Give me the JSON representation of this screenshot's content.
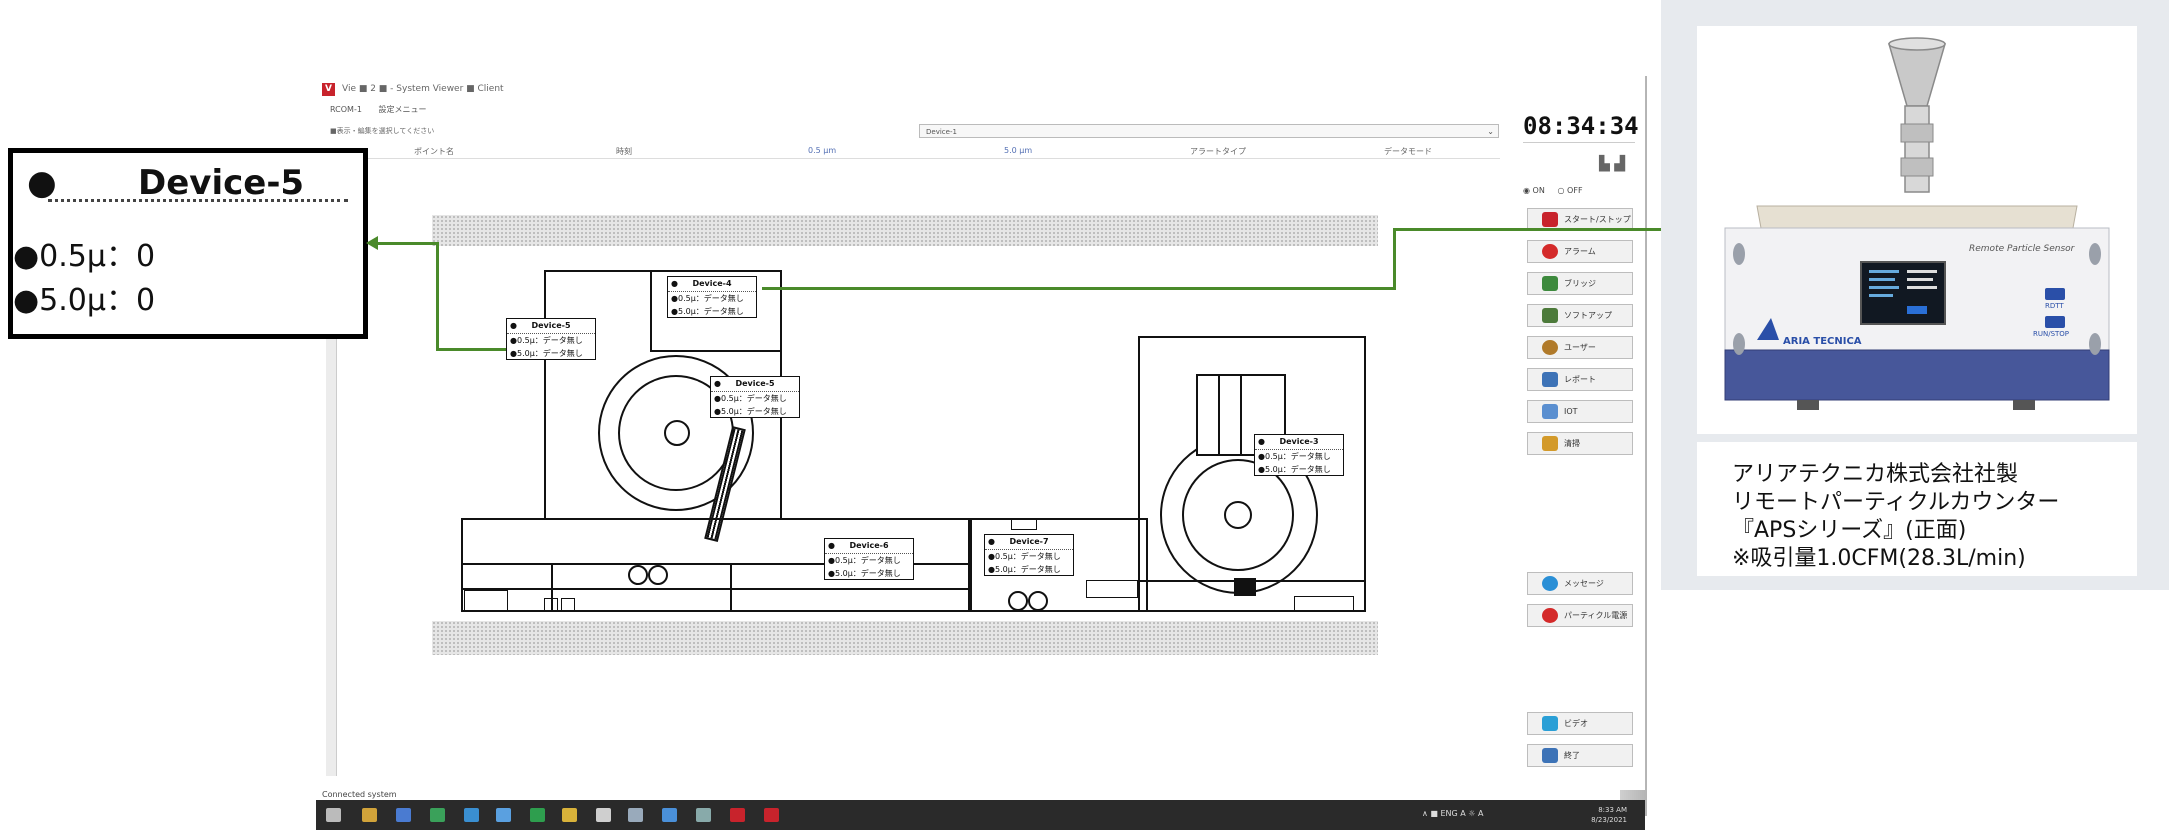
{
  "window": {
    "title": "Vie ■ 2 ■ - System Viewer ■ Client",
    "menu": [
      "RCOM-1",
      "設定メニュー"
    ],
    "toolbar_text": "■表示・編集を選択してください",
    "device_select": "Device-1",
    "columns": [
      "ポイント名",
      "時刻",
      "0.5 μm",
      "5.0 μm",
      "アラートタイプ",
      "データモード"
    ],
    "status": "Connected system"
  },
  "map_labels": [
    {
      "id": "device-5a",
      "name": "Device-5",
      "rows": [
        "●0.5μ：データ無し",
        "●5.0μ：データ無し"
      ]
    },
    {
      "id": "device-4",
      "name": "Device-4",
      "rows": [
        "●0.5μ：データ無し",
        "●5.0μ：データ無し"
      ]
    },
    {
      "id": "device-5b",
      "name": "Device-5",
      "rows": [
        "●0.5μ：データ無し",
        "●5.0μ：データ無し"
      ]
    },
    {
      "id": "device-3",
      "name": "Device-3",
      "rows": [
        "●0.5μ：データ無し",
        "●5.0μ：データ無し"
      ]
    },
    {
      "id": "device-6",
      "name": "Device-6",
      "rows": [
        "●0.5μ：データ無し",
        "●5.0μ：データ無し"
      ]
    },
    {
      "id": "device-7",
      "name": "Device-7",
      "rows": [
        "●0.5μ：データ無し",
        "●5.0μ：データ無し"
      ]
    }
  ],
  "panel": {
    "clock": "08:34:34",
    "radio_on": "◉ ON",
    "radio_off": "○ OFF",
    "buttons": [
      {
        "label": "スタート/ストップ",
        "color": "#c8232c"
      },
      {
        "label": "アラーム",
        "color": "#d42a2a"
      },
      {
        "label": "ブリッジ",
        "color": "#3d8a3d"
      },
      {
        "label": "ソフトアップ",
        "color": "#4c7a3a"
      },
      {
        "label": "ユーザー",
        "color": "#b07a2a"
      },
      {
        "label": "レポート",
        "color": "#3d73b7"
      },
      {
        "label": "IOT",
        "color": "#5a8fd0"
      },
      {
        "label": "清掃",
        "color": "#d39a2a"
      },
      {
        "label": "メッセージ",
        "color": "#2a8fd6"
      },
      {
        "label": "パーティクル電源",
        "color": "#d42a2a"
      },
      {
        "label": "ビデオ",
        "color": "#2a9fd6"
      },
      {
        "label": "終了",
        "color": "#3d73b7"
      }
    ]
  },
  "taskbar": {
    "time": "8:33 AM",
    "date": "8/23/2021",
    "tray": "∧ ■ ENG A ☼ A"
  },
  "callout": {
    "name": "Device-5",
    "bullet": "●",
    "row1": "●0.5μ：0",
    "row2": "●5.0μ：0"
  },
  "product": {
    "brand": "ARIA TECNICA",
    "device_caption": "Remote Particle Sensor",
    "btn1": "RDTT",
    "btn2": "RUN/STOP",
    "lines": [
      "アリアテクニカ株式会社社製",
      "リモートパーティクルカウンター",
      "『APSシリーズ』(正面)",
      "※吸引量1.0CFM(28.3L/min)"
    ]
  }
}
